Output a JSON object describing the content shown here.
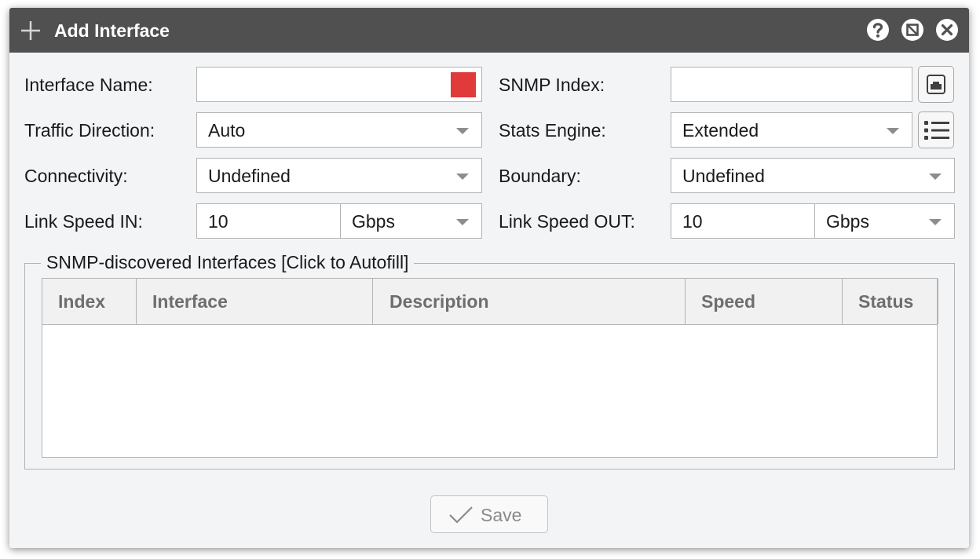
{
  "dialog": {
    "title": "Add Interface",
    "title_icon": "plus-icon",
    "title_buttons": [
      "help-icon",
      "disable-icon",
      "close-icon"
    ]
  },
  "form": {
    "interface_name": {
      "label": "Interface Name:",
      "value": "",
      "indicator_color": "#e03a3a"
    },
    "snmp_index": {
      "label": "SNMP Index:",
      "value": "",
      "button_icon": "network-port-icon"
    },
    "traffic_direction": {
      "label": "Traffic Direction:",
      "value": "Auto"
    },
    "stats_engine": {
      "label": "Stats Engine:",
      "value": "Extended",
      "button_icon": "list-icon"
    },
    "connectivity": {
      "label": "Connectivity:",
      "value": "Undefined"
    },
    "boundary": {
      "label": "Boundary:",
      "value": "Undefined"
    },
    "link_speed_in": {
      "label": "Link Speed IN:",
      "value": "10",
      "unit": "Gbps"
    },
    "link_speed_out": {
      "label": "Link Speed OUT:",
      "value": "10",
      "unit": "Gbps"
    }
  },
  "snmp_table": {
    "legend": "SNMP-discovered Interfaces [Click to Autofill]",
    "columns": [
      "Index",
      "Interface",
      "Description",
      "Speed",
      "Status"
    ],
    "rows": []
  },
  "footer": {
    "save_label": "Save",
    "save_icon": "check-icon"
  },
  "colors": {
    "titlebar": "#505050",
    "dialog_bg": "#f3f4f6",
    "required_indicator": "#e03a3a"
  }
}
